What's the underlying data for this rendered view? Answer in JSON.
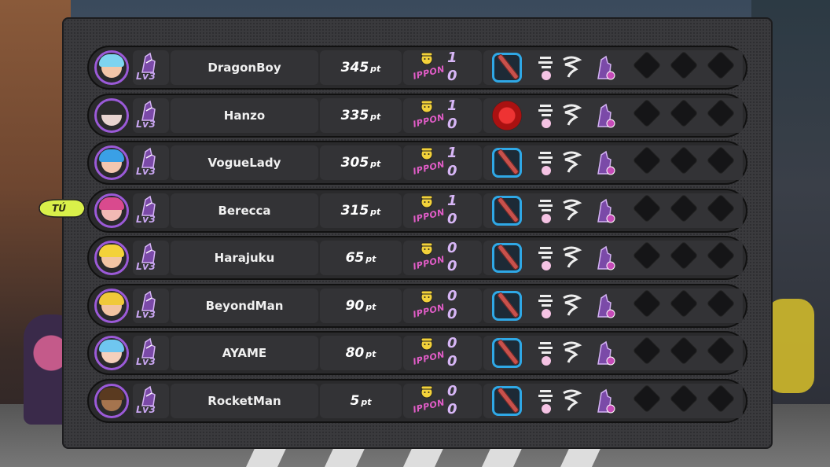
{
  "theme": {
    "panel": "#3a3a3d",
    "row": "#2a2a2c",
    "accent_purple": "#9b5ad8",
    "ippon_pink": "#e25dc8",
    "weapon_blue": "#2fa8e6",
    "you_badge": "#d9f04a"
  },
  "you_badge_label": "TÚ",
  "players": [
    {
      "name": "DragonBoy",
      "points": "345",
      "unit": "pt",
      "level": "Lv3",
      "ippon_top": "1",
      "ippon_bottom": "0",
      "ippon_label": "IPPON",
      "weapon": "bat-icon",
      "avatar_hair": "#7ed4f0",
      "avatar_face": "#f3c6a8",
      "is_you": false
    },
    {
      "name": "Hanzo",
      "points": "335",
      "unit": "pt",
      "level": "Lv3",
      "ippon_top": "1",
      "ippon_bottom": "0",
      "ippon_label": "IPPON",
      "weapon": "hammer-icon",
      "avatar_hair": "#2c2c2c",
      "avatar_face": "#e8d4d0",
      "is_you": false
    },
    {
      "name": "VogueLady",
      "points": "305",
      "unit": "pt",
      "level": "Lv3",
      "ippon_top": "1",
      "ippon_bottom": "0",
      "ippon_label": "IPPON",
      "weapon": "bat-icon",
      "avatar_hair": "#3aa0e6",
      "avatar_face": "#f4c7b0",
      "is_you": false
    },
    {
      "name": "Berecca",
      "points": "315",
      "unit": "pt",
      "level": "Lv3",
      "ippon_top": "1",
      "ippon_bottom": "0",
      "ippon_label": "IPPON",
      "weapon": "bat-icon",
      "avatar_hair": "#d94a8e",
      "avatar_face": "#f2b9b4",
      "is_you": true
    },
    {
      "name": "Harajuku",
      "points": "65",
      "unit": "pt",
      "level": "Lv3",
      "ippon_top": "0",
      "ippon_bottom": "0",
      "ippon_label": "IPPON",
      "weapon": "bat-icon",
      "avatar_hair": "#f3d23a",
      "avatar_face": "#f1c5a4",
      "is_you": false
    },
    {
      "name": "BeyondMan",
      "points": "90",
      "unit": "pt",
      "level": "Lv3",
      "ippon_top": "0",
      "ippon_bottom": "0",
      "ippon_label": "IPPON",
      "weapon": "bat-icon",
      "avatar_hair": "#f0c93a",
      "avatar_face": "#f2c3a2",
      "is_you": false
    },
    {
      "name": "AYAME",
      "points": "80",
      "unit": "pt",
      "level": "Lv3",
      "ippon_top": "0",
      "ippon_bottom": "0",
      "ippon_label": "IPPON",
      "weapon": "bat-icon",
      "avatar_hair": "#6fc6f0",
      "avatar_face": "#f4d0bc",
      "is_you": false
    },
    {
      "name": "RocketMan",
      "points": "5",
      "unit": "pt",
      "level": "Lv3",
      "ippon_top": "0",
      "ippon_bottom": "0",
      "ippon_label": "IPPON",
      "weapon": "bat-icon",
      "avatar_hair": "#5a3a20",
      "avatar_face": "#a5744e",
      "is_you": false
    }
  ],
  "skill_icons": [
    "dash-skill-icon",
    "tornado-skill-icon",
    "boot-level-icon"
  ],
  "empty_slots": 3
}
